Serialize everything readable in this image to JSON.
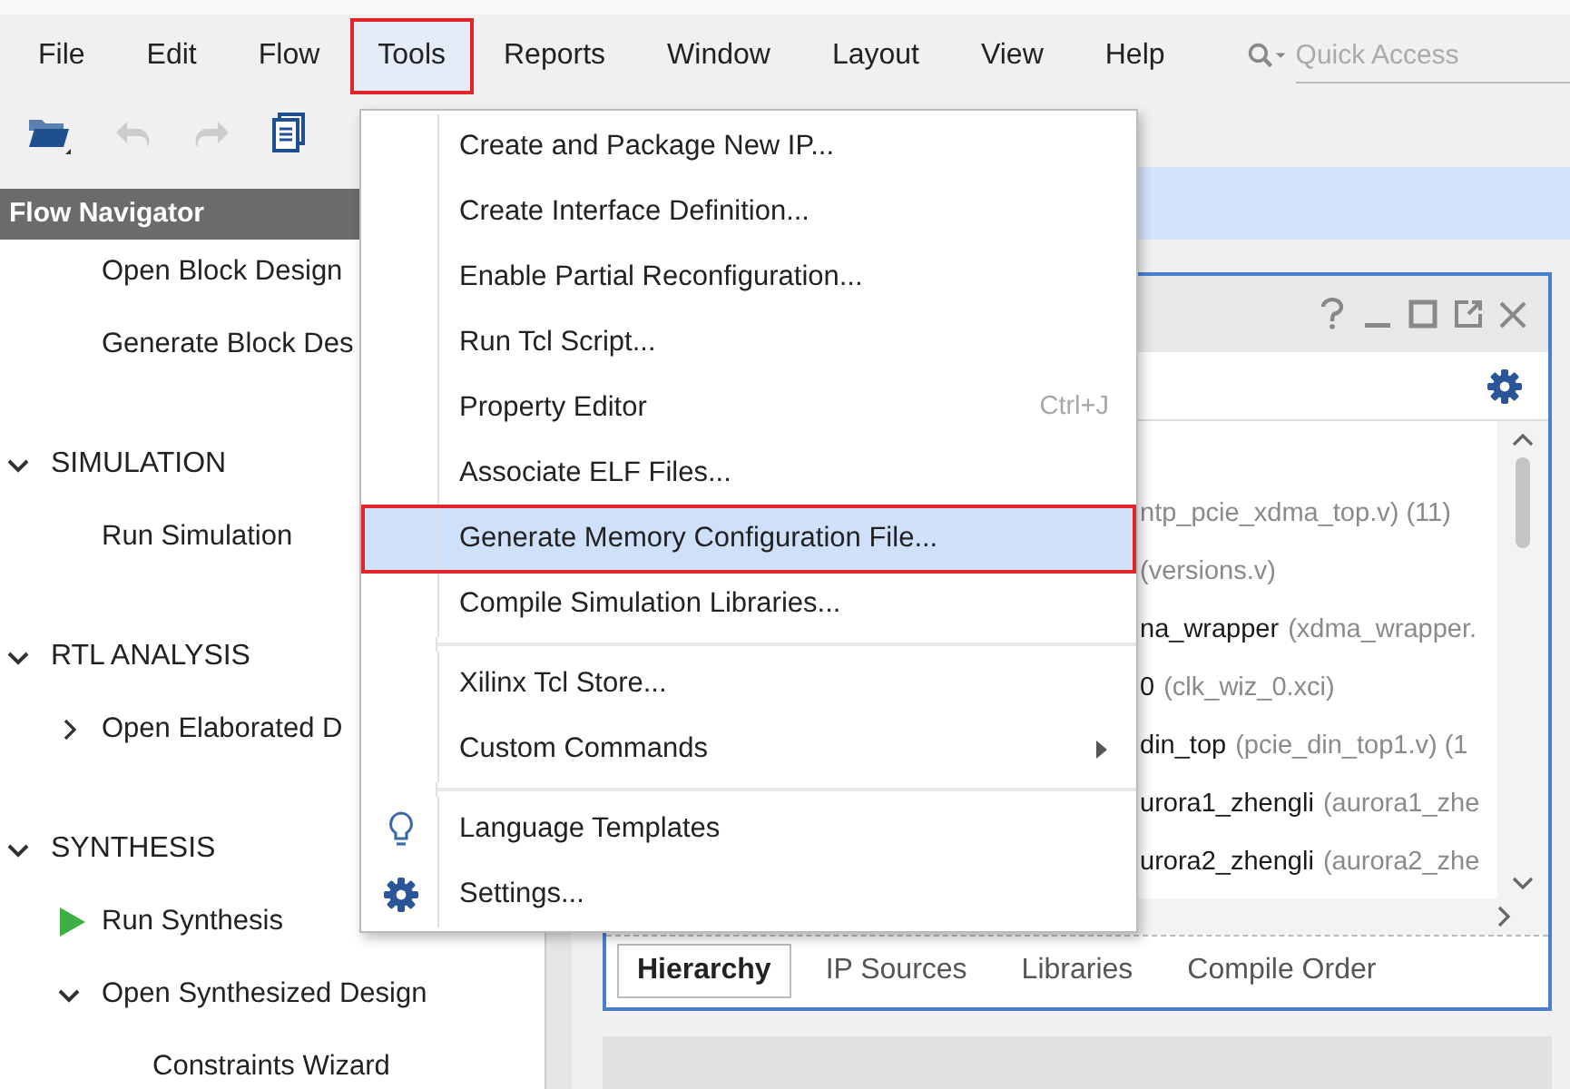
{
  "menubar": [
    {
      "label": "File",
      "selected": false
    },
    {
      "label": "Edit",
      "selected": false
    },
    {
      "label": "Flow",
      "selected": false
    },
    {
      "label": "Tools",
      "selected": true
    },
    {
      "label": "Reports",
      "selected": false
    },
    {
      "label": "Window",
      "selected": false
    },
    {
      "label": "Layout",
      "selected": false
    },
    {
      "label": "View",
      "selected": false
    },
    {
      "label": "Help",
      "selected": false
    }
  ],
  "quick_access": {
    "placeholder": "Quick Access"
  },
  "toolbar": [
    {
      "disabled": false
    },
    {
      "disabled": true
    },
    {
      "disabled": true
    },
    {
      "disabled": false
    }
  ],
  "flow_navigator": {
    "title": "Flow Navigator",
    "items": [
      {
        "kind": "task",
        "label": "Open Block Design"
      },
      {
        "kind": "task",
        "label": "Generate Block Des"
      },
      {
        "kind": "section",
        "label": "SIMULATION",
        "expanded": true,
        "children": [
          {
            "kind": "task",
            "label": "Run Simulation"
          }
        ]
      },
      {
        "kind": "section",
        "label": "RTL ANALYSIS",
        "expanded": true,
        "children": [
          {
            "kind": "task",
            "label": "Open Elaborated D",
            "expanded": false
          }
        ]
      },
      {
        "kind": "section",
        "label": "SYNTHESIS",
        "expanded": true,
        "children": [
          {
            "kind": "run",
            "label": "Run Synthesis"
          },
          {
            "kind": "task",
            "label": "Open Synthesized Design",
            "expanded": true,
            "children": [
              {
                "kind": "task",
                "label": "Constraints Wizard"
              }
            ]
          }
        ]
      }
    ]
  },
  "tools_menu": [
    {
      "kind": "item",
      "label": "Create and Package New IP...",
      "highlighted": false
    },
    {
      "kind": "item",
      "label": "Create Interface Definition...",
      "highlighted": false
    },
    {
      "kind": "item",
      "label": "Enable Partial Reconfiguration...",
      "highlighted": false
    },
    {
      "kind": "item",
      "label": "Run Tcl Script...",
      "highlighted": false
    },
    {
      "kind": "item",
      "label": "Property Editor",
      "shortcut": "Ctrl+J",
      "highlighted": false
    },
    {
      "kind": "item",
      "label": "Associate ELF Files...",
      "highlighted": false
    },
    {
      "kind": "item",
      "label": "Generate Memory Configuration File...",
      "highlighted": true
    },
    {
      "kind": "item",
      "label": "Compile Simulation Libraries...",
      "highlighted": false
    },
    {
      "kind": "separator"
    },
    {
      "kind": "item",
      "label": "Xilinx Tcl Store...",
      "highlighted": false
    },
    {
      "kind": "item",
      "label": "Custom Commands",
      "submenu": true,
      "highlighted": false
    },
    {
      "kind": "separator"
    },
    {
      "kind": "bulb-item",
      "label": "Language Templates",
      "highlighted": false
    },
    {
      "kind": "gear-item",
      "label": "Settings...",
      "highlighted": false
    }
  ],
  "sources_panel": {
    "rows": [
      {
        "file": "ntp_pcie_xdma_top.v) (11)"
      },
      {
        "file": "(versions.v)"
      },
      {
        "name": "na_wrapper",
        "file": "(xdma_wrapper."
      },
      {
        "name": "0",
        "file": "(clk_wiz_0.xci)"
      },
      {
        "name": "din_top",
        "file": "(pcie_din_top1.v) (1"
      },
      {
        "name": "urora1_zhengli",
        "file": "(aurora1_zhe"
      },
      {
        "name": "urora2_zhengli",
        "file": "(aurora2_zhe"
      }
    ],
    "tabs": [
      {
        "label": "Hierarchy",
        "selected": true
      },
      {
        "label": "IP Sources",
        "selected": false
      },
      {
        "label": "Libraries",
        "selected": false
      },
      {
        "label": "Compile Order",
        "selected": false
      }
    ]
  }
}
